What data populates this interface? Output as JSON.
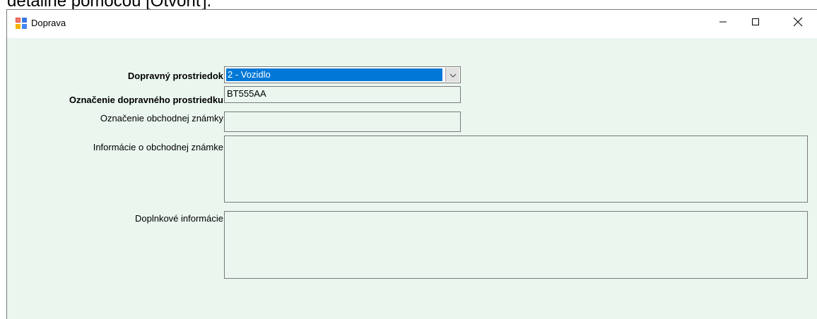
{
  "background_text": "detailne pomocou [Otvoriť].",
  "window": {
    "title": "Doprava",
    "icons": {
      "app": "app-form-icon",
      "minimize": "minimize-icon",
      "maximize": "maximize-icon",
      "close": "close-icon"
    }
  },
  "form": {
    "transport_means": {
      "label": "Dopravný prostriedok",
      "selected_value": "2 - Vozidlo"
    },
    "vehicle_id": {
      "label": "Označenie dopravného prostriedku",
      "value": "BT555AA"
    },
    "trademark_id": {
      "label": "Označenie obchodnej známky",
      "value": ""
    },
    "trademark_info": {
      "label": "Informácie o obchodnej známke",
      "value": ""
    },
    "additional_info": {
      "label": "Doplnkové informácie",
      "value": ""
    }
  },
  "colors": {
    "client_background": "#ebf6ef",
    "selection": "#0078d7",
    "border": "#7a7a7a"
  }
}
